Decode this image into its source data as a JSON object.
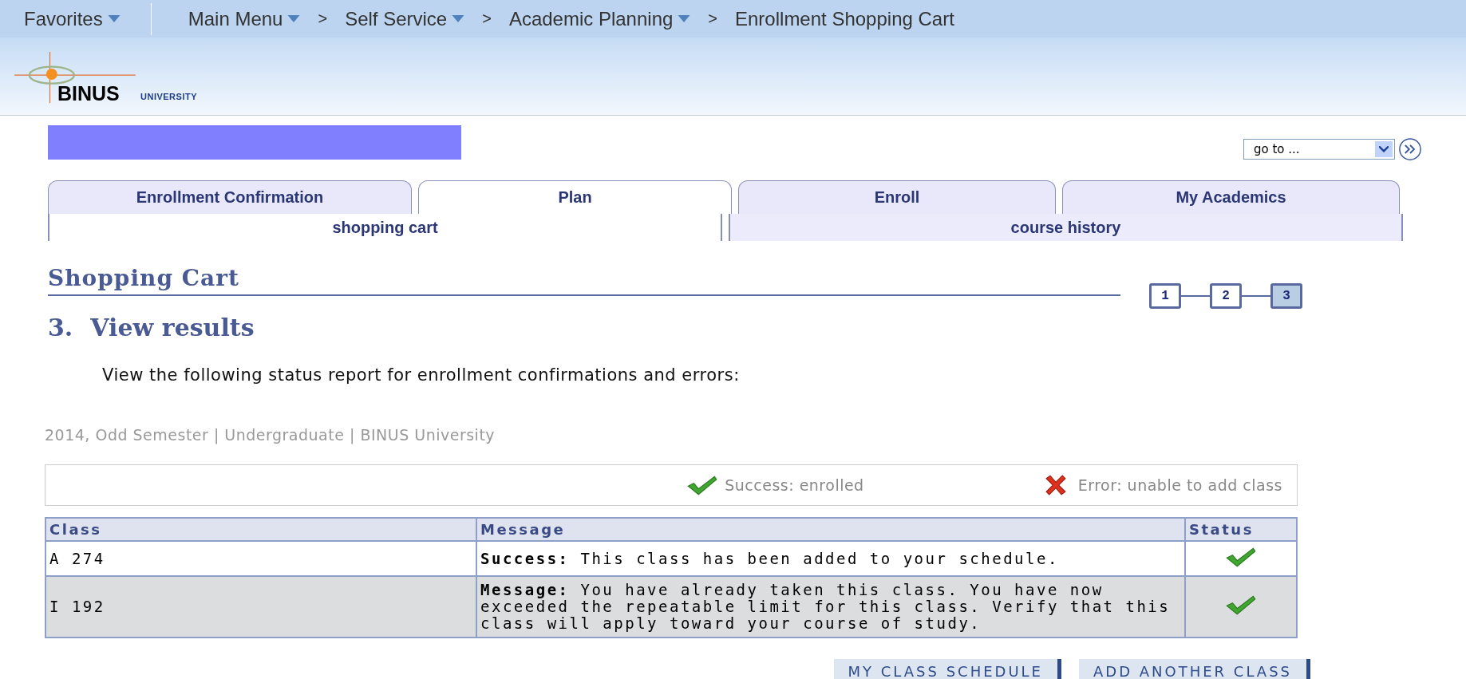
{
  "top_bar": {
    "favorites": {
      "label": "Favorites",
      "has_menu": true
    },
    "breadcrumbs": [
      {
        "label": "Main Menu",
        "has_menu": true
      },
      {
        "label": "Self Service",
        "has_menu": true
      },
      {
        "label": "Academic Planning",
        "has_menu": true
      },
      {
        "label": "Enrollment Shopping Cart",
        "has_menu": false
      }
    ],
    "separator": ">"
  },
  "logo": {
    "name": "BINUS",
    "subtitle": "UNIVERSITY"
  },
  "goto": {
    "value": "go to ..."
  },
  "tabs": [
    {
      "label": "Enrollment Confirmation",
      "selected": false
    },
    {
      "label": "Plan",
      "selected": true
    },
    {
      "label": "Enroll",
      "selected": false
    },
    {
      "label": "My Academics",
      "selected": false
    }
  ],
  "subtabs": [
    {
      "label": "shopping cart",
      "selected": true
    },
    {
      "label": "course history",
      "selected": false
    }
  ],
  "section_title": "Shopping Cart",
  "steps": [
    {
      "label": "1",
      "selected": false
    },
    {
      "label": "2",
      "selected": false
    },
    {
      "label": "3",
      "selected": true
    }
  ],
  "step_heading": {
    "number": "3.",
    "title": "View results"
  },
  "instructions": "View the following status report for enrollment confirmations and errors:",
  "term": "2014, Odd Semester | Undergraduate | BINUS University",
  "legend": [
    {
      "kind": "success",
      "label": "Success: enrolled"
    },
    {
      "kind": "error",
      "label": "Error: unable to add class"
    }
  ],
  "table": {
    "columns": [
      "Class",
      "Message",
      "Status"
    ],
    "rows": [
      {
        "class": "A  274",
        "message": "**Success:** This class has been added to your schedule.",
        "kind": "success",
        "shaded": false
      },
      {
        "class": "I  192",
        "message": "**Message:** You have already taken this class. You have now exceeded the repeatable limit for this class. Verify that this class will apply toward your course of study.",
        "kind": "success",
        "shaded": true
      }
    ]
  },
  "buttons": [
    "MY CLASS SCHEDULE",
    "ADD ANOTHER CLASS"
  ]
}
